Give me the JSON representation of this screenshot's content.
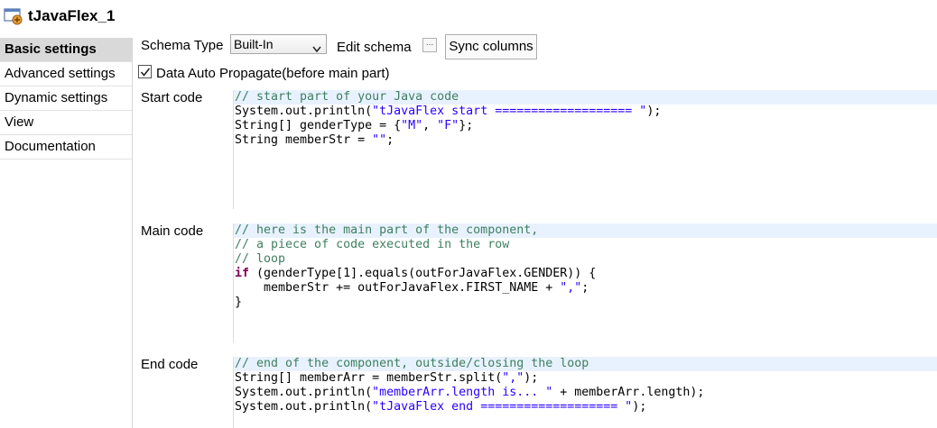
{
  "title": "tJavaFlex_1",
  "sidebar": {
    "items": [
      {
        "label": "Basic settings",
        "active": true
      },
      {
        "label": "Advanced settings",
        "active": false
      },
      {
        "label": "Dynamic settings",
        "active": false
      },
      {
        "label": "View",
        "active": false
      },
      {
        "label": "Documentation",
        "active": false
      }
    ]
  },
  "schema": {
    "label": "Schema Type",
    "selected": "Built-In",
    "edit_label": "Edit schema",
    "edit_button": "...",
    "sync_label": "Sync columns"
  },
  "propagate": {
    "label": "Data Auto Propagate(before main part)",
    "checked": true
  },
  "start_code": {
    "label": "Start code",
    "line0": "// start part of your Java code",
    "line1": {
      "a": "System.out.println(",
      "b": "\"tJavaFlex start =================== \"",
      "c": ");"
    },
    "line2": {
      "a": "String[] genderType = {",
      "b": "\"M\"",
      "c": ", ",
      "d": "\"F\"",
      "e": "};"
    },
    "line3": {
      "a": "String memberStr = ",
      "b": "\"\"",
      "c": ";"
    }
  },
  "main_code": {
    "label": "Main code",
    "line0": "// here is the main part of the component,",
    "line1": "// a piece of code executed in the row",
    "line2": "// loop",
    "line3": {
      "kw": "if",
      "rest": " (genderType[1].equals(outForJavaFlex.GENDER)) {"
    },
    "line4": {
      "a": "    memberStr += outForJavaFlex.FIRST_NAME + ",
      "b": "\",\"",
      "c": ";"
    },
    "line5": "}"
  },
  "end_code": {
    "label": "End code",
    "line0": "// end of the component, outside/closing the loop",
    "line1": {
      "a": "String[] memberArr = memberStr.split(",
      "b": "\",\"",
      "c": ");"
    },
    "line2": {
      "a": "System.out.println(",
      "b": "\"memberArr.length is... \"",
      "c": " + memberArr.length);"
    },
    "line3": {
      "a": "System.out.println(",
      "b": "\"tJavaFlex end =================== \"",
      "c": ");"
    }
  },
  "colors": {
    "comment": "#3f7f5f",
    "string": "#2a00ff",
    "keyword": "#7f0055",
    "highlight_line": "#e8f2fe",
    "active_tab": "#d9d9d9"
  }
}
